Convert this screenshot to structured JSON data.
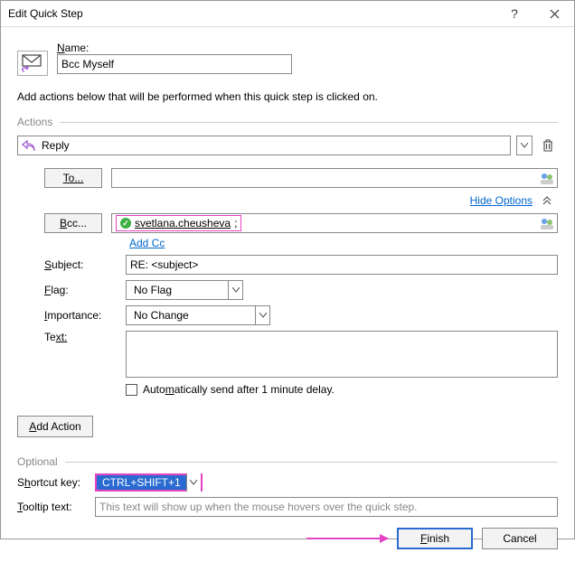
{
  "window": {
    "title": "Edit Quick Step"
  },
  "name": {
    "label_pre": "N",
    "label_post": "ame:",
    "value": "Bcc Myself"
  },
  "instructions": "Add actions below that will be performed when this quick step is clicked on.",
  "actions_label": "Actions",
  "action": {
    "type": "Reply"
  },
  "to": {
    "label": "To...",
    "value": ""
  },
  "hide_options": "Hide Options",
  "bcc": {
    "label_pre": "B",
    "label_post": "cc...",
    "chip": "svetlana.cheusheva",
    "chip_suffix": ";"
  },
  "add_cc": "Add Cc",
  "subject": {
    "label_pre": "S",
    "label_post": "ubject:",
    "value": "RE: <subject>"
  },
  "flag": {
    "label_pre": "F",
    "label_post": "lag:",
    "value": "No Flag"
  },
  "importance": {
    "label_pre": "I",
    "label_post": "mportance:",
    "value": "No Change"
  },
  "text": {
    "label_pre": "Te",
    "label_post": "xt:",
    "value": ""
  },
  "auto_send": {
    "pre": "Auto",
    "u": "m",
    "post": "atically send after 1 minute delay."
  },
  "add_action": {
    "pre": "A",
    "u": "d",
    "post": "d Action"
  },
  "optional_label": "Optional",
  "shortcut": {
    "label_pre": "S",
    "label_u": "h",
    "label_post": "ortcut key:",
    "value": "CTRL+SHIFT+1"
  },
  "tooltip": {
    "label_pre": "T",
    "label_post": "ooltip text:",
    "placeholder": "This text will show up when the mouse hovers over the quick step."
  },
  "buttons": {
    "finish_pre": "F",
    "finish_post": "inish",
    "cancel": "Cancel"
  }
}
